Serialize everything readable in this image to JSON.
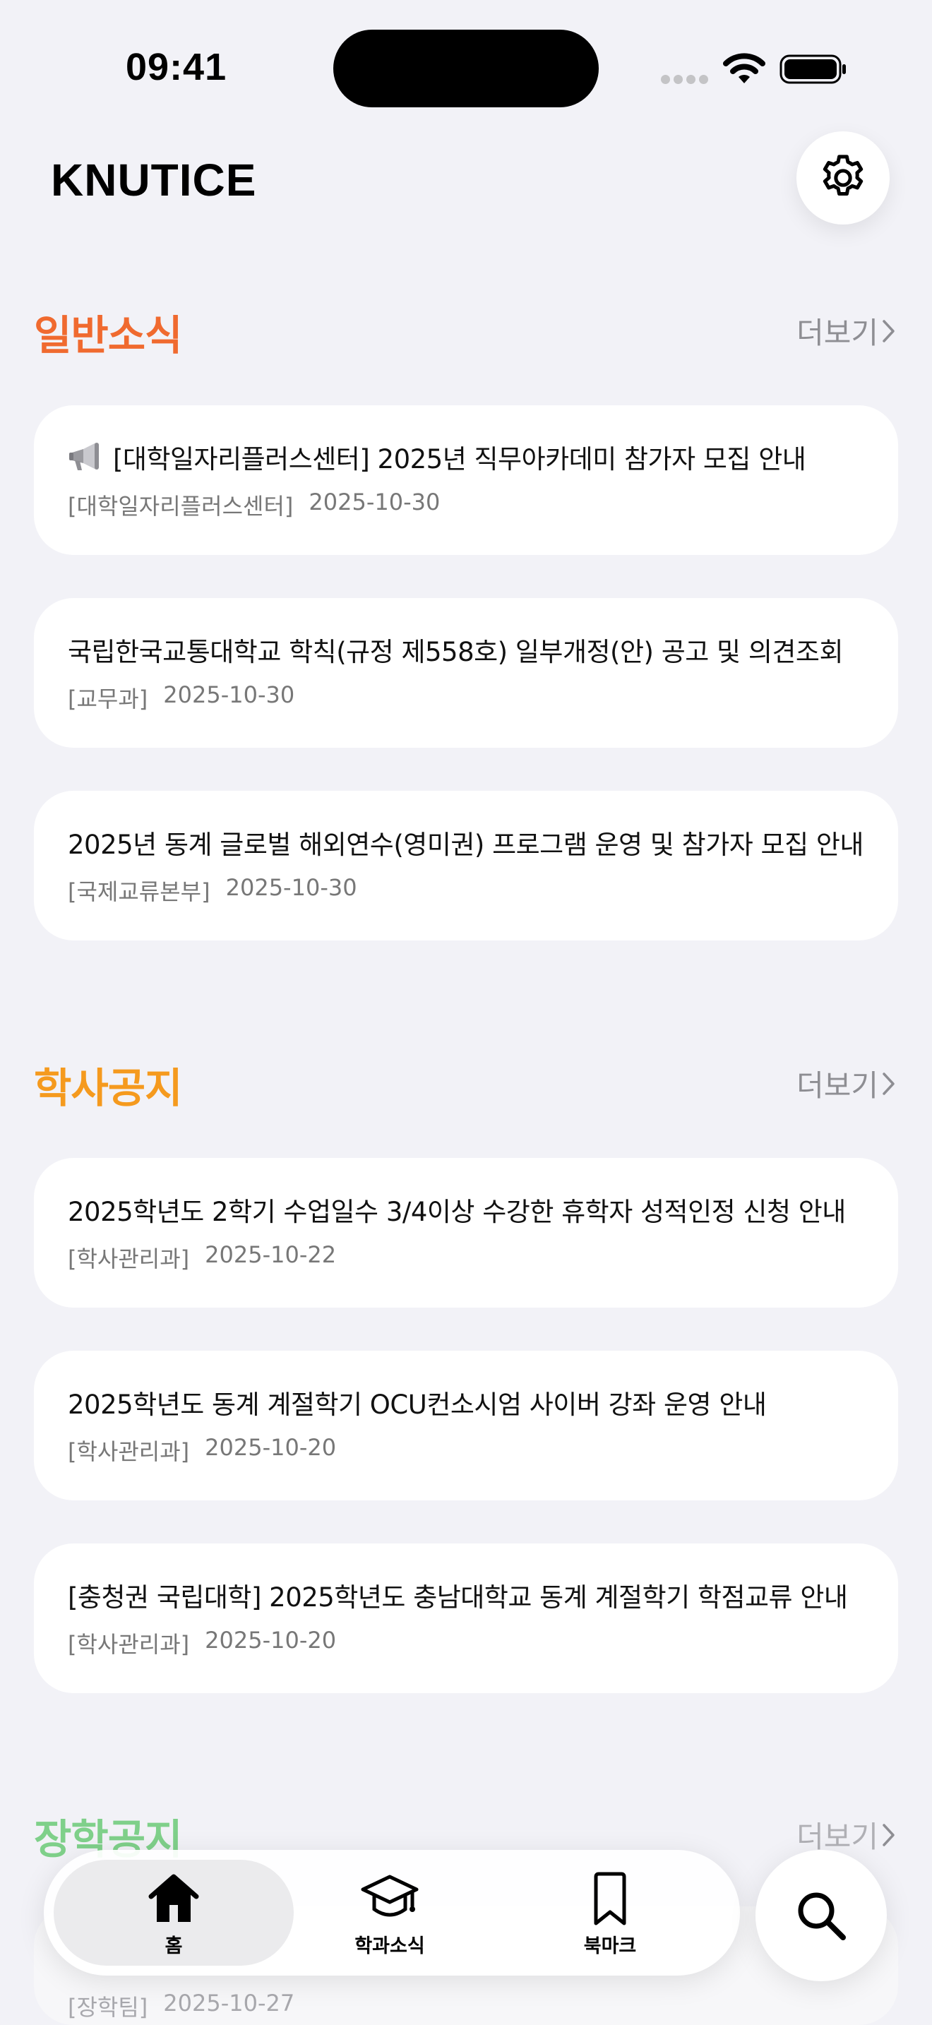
{
  "status": {
    "time": "09:41"
  },
  "header": {
    "title": "KNUTICE"
  },
  "sections": [
    {
      "title": "일반소식",
      "more": "더보기",
      "color": "#f06a2f",
      "items": [
        {
          "icon": "megaphone-icon",
          "title": "[대학일자리플러스센터] 2025년 직무아카데미 참가자 모집 안내",
          "dept": "[대학일자리플러스센터]",
          "date": "2025-10-30"
        },
        {
          "title": "국립한국교통대학교 학칙(규정 제558호) 일부개정(안) 공고 및 의견조회",
          "dept": "[교무과]",
          "date": "2025-10-30"
        },
        {
          "title": "2025년 동계 글로벌 해외연수(영미권) 프로그램 운영 및 참가자 모집 안내",
          "dept": "[국제교류본부]",
          "date": "2025-10-30"
        }
      ]
    },
    {
      "title": "학사공지",
      "more": "더보기",
      "color": "#f59a1e",
      "items": [
        {
          "title": "2025학년도 2학기 수업일수 3/4이상 수강한 휴학자 성적인정 신청 안내",
          "dept": "[학사관리과]",
          "date": "2025-10-22"
        },
        {
          "title": "2025학년도 동계 계절학기 OCU컨소시엄 사이버 강좌 운영 안내",
          "dept": "[학사관리과]",
          "date": "2025-10-20"
        },
        {
          "title": "[충청권 국립대학] 2025학년도 충남대학교 동계 계절학기 학점교류 안내",
          "dept": "[학사관리과]",
          "date": "2025-10-20"
        }
      ]
    },
    {
      "title": "장학공지",
      "more": "더보기",
      "color": "#7fd08a",
      "items": [
        {
          "title": "",
          "dept": "[장학팀]",
          "date": "2025-10-27"
        }
      ]
    }
  ],
  "tabbar": {
    "tabs": [
      {
        "label": "홈",
        "icon": "home-icon"
      },
      {
        "label": "학과소식",
        "icon": "graduation-cap-icon"
      },
      {
        "label": "북마크",
        "icon": "bookmark-icon"
      }
    ]
  }
}
